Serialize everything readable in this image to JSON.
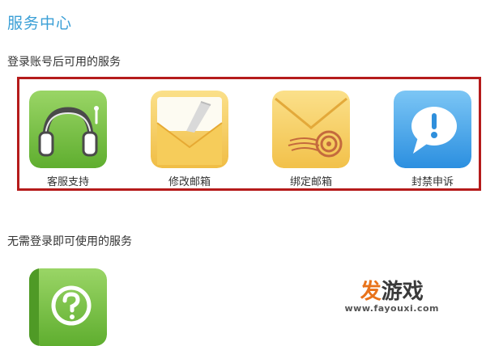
{
  "page": {
    "title": "服务中心"
  },
  "sections": {
    "logged_in_title": "登录账号后可用的服务",
    "no_login_title": "无需登录即可使用的服务"
  },
  "services": [
    {
      "label": "客服支持",
      "icon": "headset-icon"
    },
    {
      "label": "修改邮箱",
      "icon": "envelope-pen-icon"
    },
    {
      "label": "绑定邮箱",
      "icon": "envelope-stamp-icon"
    },
    {
      "label": "封禁申诉",
      "icon": "speech-bubble-exclamation-icon"
    }
  ],
  "no_login_services": [
    {
      "label": "",
      "icon": "help-book-icon"
    }
  ],
  "watermark": {
    "logo_part1": "发",
    "logo_part2": "游戏",
    "url": "www.fayouxi.com"
  },
  "colors": {
    "title_blue": "#3a9fd6",
    "highlight_red": "#b51b1b",
    "green": "#7cc24a",
    "yellow": "#f5cf63",
    "blue": "#4aa8ea"
  }
}
